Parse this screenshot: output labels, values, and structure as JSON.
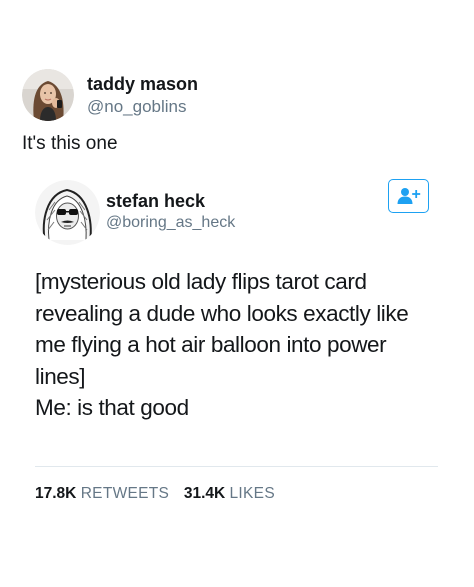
{
  "outer_tweet": {
    "author_name": "taddy mason",
    "author_handle": "@no_goblins",
    "avatar_icon": "user-photo-avatar",
    "text": "It's this one"
  },
  "quoted_tweet": {
    "author_name": "stefan heck",
    "author_handle": "@boring_as_heck",
    "avatar_icon": "sketch-portrait-avatar",
    "follow_icon": "add-user-icon",
    "body_lines": [
      "[mysterious old lady flips tarot card",
      "revealing a dude who looks exactly like",
      "me flying a hot air balloon into power",
      "lines]",
      "Me: is that good"
    ],
    "retweets_count": "17.8K",
    "retweets_label": "RETWEETS",
    "likes_count": "31.4K",
    "likes_label": "LIKES"
  },
  "colors": {
    "accent": "#1da1f2",
    "text_primary": "#14171a",
    "text_secondary": "#657786",
    "divider": "#e1e8ed"
  }
}
